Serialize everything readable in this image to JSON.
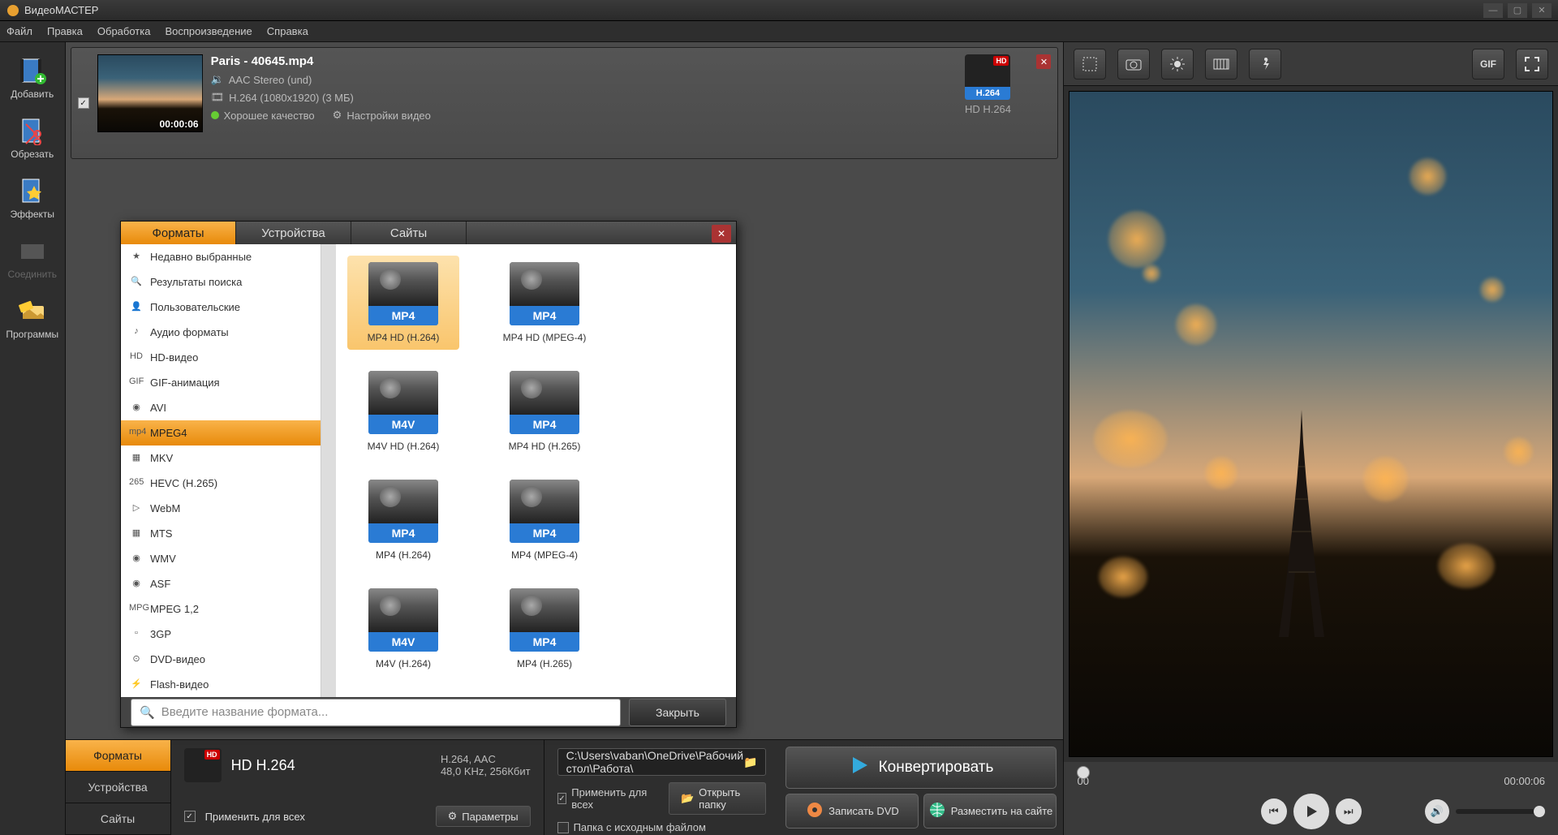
{
  "app": {
    "title": "ВидеоМАСТЕР"
  },
  "menu": [
    "Файл",
    "Правка",
    "Обработка",
    "Воспроизведение",
    "Справка"
  ],
  "sidebar": [
    {
      "label": "Добавить",
      "disabled": false
    },
    {
      "label": "Обрезать",
      "disabled": false
    },
    {
      "label": "Эффекты",
      "disabled": false
    },
    {
      "label": "Соединить",
      "disabled": true
    },
    {
      "label": "Программы",
      "disabled": false
    }
  ],
  "file": {
    "name": "Paris - 40645.mp4",
    "audio": "AAC Stereo (und)",
    "video": "H.264 (1080x1920) (3 МБ)",
    "quality": "Хорошее качество",
    "settings": "Настройки видео",
    "duration": "00:00:06",
    "format_badge": "H.264",
    "format_label": "HD H.264"
  },
  "preview": {
    "time_start": "00",
    "time_end": "00:00:06"
  },
  "bottom": {
    "tabs": [
      "Форматы",
      "Устройства",
      "Сайты"
    ],
    "selected_format": "HD H.264",
    "codec_line1": "H.264, AAC",
    "codec_line2": "48,0 KHz, 256Кбит",
    "apply_all": "Применить для всех",
    "params": "Параметры",
    "path": "C:\\Users\\vaban\\OneDrive\\Рабочий стол\\Работа\\",
    "apply_all2": "Применить для всех",
    "source_folder": "Папка с исходным файлом",
    "open_folder": "Открыть папку",
    "convert": "Конвертировать",
    "burn_dvd": "Записать DVD",
    "publish": "Разместить на сайте"
  },
  "dialog": {
    "tabs": [
      "Форматы",
      "Устройства",
      "Сайты"
    ],
    "categories": [
      "Недавно выбранные",
      "Результаты поиска",
      "Пользовательские",
      "Аудио форматы",
      "HD-видео",
      "GIF-анимация",
      "AVI",
      "MPEG4",
      "MKV",
      "HEVC (H.265)",
      "WebM",
      "MTS",
      "WMV",
      "ASF",
      "MPEG 1,2",
      "3GP",
      "DVD-видео",
      "Flash-видео"
    ],
    "selected_category": "MPEG4",
    "formats": [
      {
        "tag": "MP4",
        "hd": true,
        "label": "MP4 HD (H.264)",
        "selected": true
      },
      {
        "tag": "MP4",
        "hd": true,
        "label": "MP4 HD (MPEG-4)"
      },
      {
        "tag": "M4V",
        "hd": true,
        "label": "M4V HD (H.264)"
      },
      {
        "tag": "MP4",
        "hd": true,
        "label": "MP4 HD (H.265)"
      },
      {
        "tag": "MP4",
        "hd": false,
        "label": "MP4 (H.264)"
      },
      {
        "tag": "MP4",
        "hd": false,
        "label": "MP4 (MPEG-4)"
      },
      {
        "tag": "M4V",
        "hd": false,
        "label": "M4V (H.264)"
      },
      {
        "tag": "MP4",
        "hd": false,
        "label": "MP4 (H.265)"
      }
    ],
    "search_placeholder": "Введите название формата...",
    "close": "Закрыть"
  }
}
